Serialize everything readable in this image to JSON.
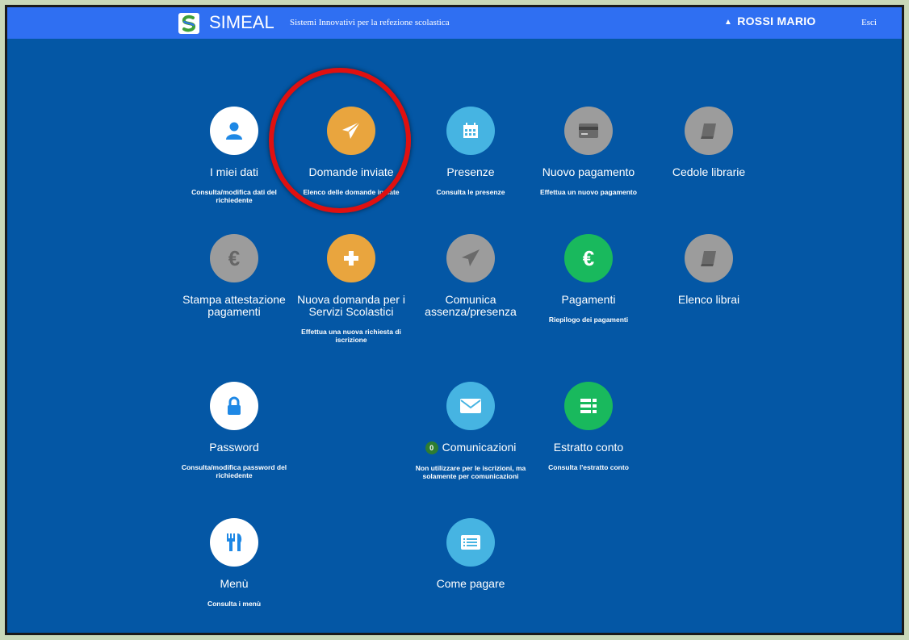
{
  "header": {
    "brand": "SIMEAL",
    "tagline": "Sistemi Innovativi per la refezione scolastica",
    "user_name": "ROSSI MARIO",
    "logout_label": "Esci"
  },
  "tiles": [
    {
      "title": "I miei dati",
      "desc": "Consulta/modifica dati del richiedente",
      "icon": "user-icon"
    },
    {
      "title": "Domande inviate",
      "desc": "Elenco delle domande inviate",
      "icon": "paper-plane-icon"
    },
    {
      "title": "Presenze",
      "desc": "Consulta le presenze",
      "icon": "calendar-icon"
    },
    {
      "title": "Nuovo pagamento",
      "desc": "Effettua un nuovo pagamento",
      "icon": "credit-card-icon"
    },
    {
      "title": "Cedole librarie",
      "desc": "",
      "icon": "book-icon"
    },
    {
      "title": "Stampa attestazione pagamenti",
      "desc": "",
      "icon": "euro-icon"
    },
    {
      "title": "Nuova domanda per i Servizi Scolastici",
      "desc": "Effettua una nuova richiesta di iscrizione",
      "icon": "plus-icon"
    },
    {
      "title": "Comunica assenza/presenza",
      "desc": "",
      "icon": "paper-plane-icon"
    },
    {
      "title": "Pagamenti",
      "desc": "Riepilogo dei pagamenti",
      "icon": "euro-icon"
    },
    {
      "title": "Elenco librai",
      "desc": "",
      "icon": "book-icon"
    },
    {
      "title": "Password",
      "desc": "Consulta/modifica password del richiedente",
      "icon": "lock-icon"
    },
    {
      "title": "Comunicazioni",
      "desc": "Non utilizzare per le iscrizioni, ma solamente per comunicazioni",
      "icon": "envelope-icon",
      "badge": "0"
    },
    {
      "title": "Estratto conto",
      "desc": "Consulta l'estratto conto",
      "icon": "list-icon"
    },
    {
      "title": "Menù",
      "desc": "Consulta i menù",
      "icon": "cutlery-icon"
    },
    {
      "title": "Come pagare",
      "desc": "",
      "icon": "list-alt-icon"
    }
  ],
  "colors": {
    "page_bg": "#0457a5",
    "topbar": "#2f6ff2",
    "white": "#ffffff",
    "orange": "#e9a53e",
    "light_blue": "#46b4e2",
    "grey": "#9c9c9c",
    "green": "#19b95d",
    "highlight_ring": "#e01010"
  }
}
